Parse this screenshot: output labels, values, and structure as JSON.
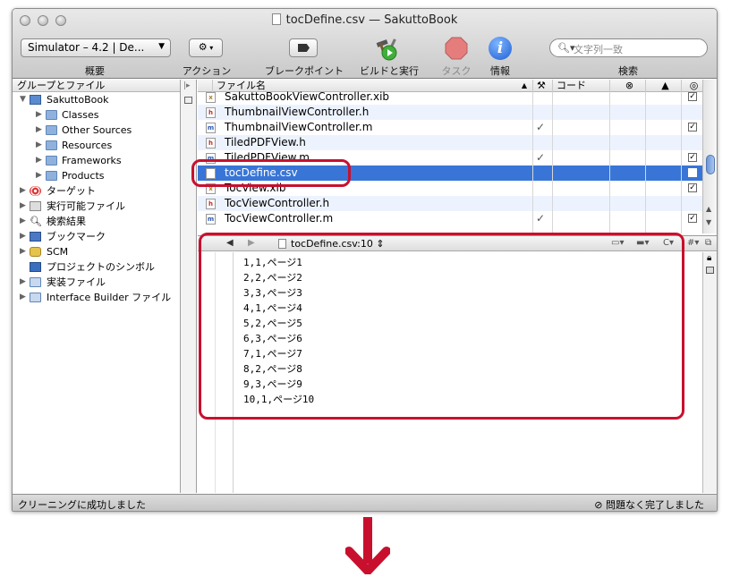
{
  "window": {
    "title": "tocDefine.csv — SakuttoBook"
  },
  "toolbar": {
    "scheme_popup": "Simulator – 4.2 | De...",
    "overview_label": "概要",
    "action_label": "アクション",
    "breakpoints_label": "ブレークポイント",
    "build_and_run_label": "ビルドと実行",
    "tasks_label": "タスク",
    "info_label": "情報",
    "search_placeholder": "文字列一致",
    "search_label": "検索"
  },
  "sidebar": {
    "header": "グループとファイル",
    "items": [
      {
        "label": "SakuttoBook"
      },
      {
        "label": "Classes"
      },
      {
        "label": "Other Sources"
      },
      {
        "label": "Resources"
      },
      {
        "label": "Frameworks"
      },
      {
        "label": "Products"
      },
      {
        "label": "ターゲット"
      },
      {
        "label": "実行可能ファイル"
      },
      {
        "label": "検索結果"
      },
      {
        "label": "ブックマーク"
      },
      {
        "label": "SCM"
      },
      {
        "label": "プロジェクトのシンボル"
      },
      {
        "label": "実装ファイル"
      },
      {
        "label": "Interface Builder ファイル"
      }
    ]
  },
  "file_list": {
    "columns": {
      "name": "ファイル名",
      "code": "コード"
    },
    "rows": [
      {
        "name": "SakuttoBookViewController.xib",
        "type": "x",
        "built": false,
        "target": true
      },
      {
        "name": "ThumbnailViewController.h",
        "type": "h",
        "built": false,
        "target": false
      },
      {
        "name": "ThumbnailViewController.m",
        "type": "m",
        "built": true,
        "target": true
      },
      {
        "name": "TiledPDFView.h",
        "type": "h",
        "built": false,
        "target": false
      },
      {
        "name": "TiledPDFView.m",
        "type": "m",
        "built": true,
        "target": true
      },
      {
        "name": "tocDefine.csv",
        "type": "doc",
        "built": false,
        "target": true,
        "selected": true
      },
      {
        "name": "TocView.xib",
        "type": "x",
        "built": false,
        "target": true
      },
      {
        "name": "TocViewController.h",
        "type": "h",
        "built": false,
        "target": false
      },
      {
        "name": "TocViewController.m",
        "type": "m",
        "built": true,
        "target": true
      }
    ]
  },
  "editor": {
    "path": "tocDefine.csv:10",
    "lines": [
      "1,1,ページ1",
      "2,2,ページ2",
      "3,3,ページ3",
      "4,1,ページ4",
      "5,2,ページ5",
      "6,3,ページ6",
      "7,1,ページ7",
      "8,2,ページ8",
      "9,3,ページ9",
      "10,1,ページ10"
    ]
  },
  "statusbar": {
    "left": "クリーニングに成功しました",
    "right": "問題なく完了しました"
  },
  "colors": {
    "selection": "#3875d7",
    "annotation": "#c8102e",
    "alt_row": "#edf3fe"
  }
}
